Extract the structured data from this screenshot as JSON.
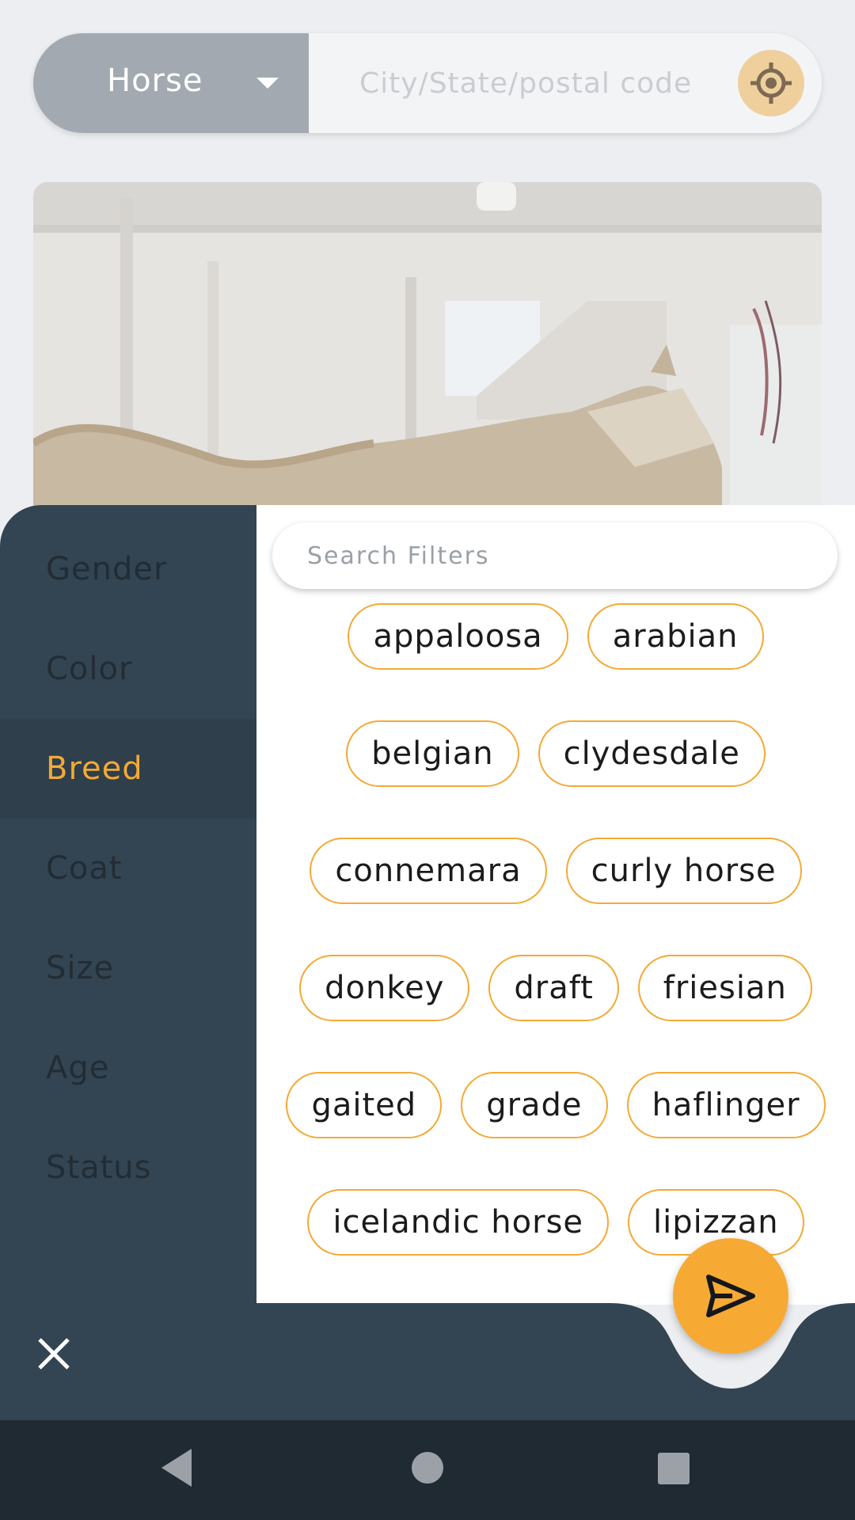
{
  "search_bar": {
    "species_value": "Horse",
    "location_placeholder": "City/State/postal code"
  },
  "filters": {
    "search_placeholder": "Search Filters",
    "categories": [
      "Gender",
      "Color",
      "Breed",
      "Coat",
      "Size",
      "Age",
      "Status"
    ],
    "active_category": "Breed",
    "breed_chip_rows": [
      [
        "appaloosa",
        "arabian"
      ],
      [
        "belgian",
        "clydesdale"
      ],
      [
        "connemara",
        "curly horse"
      ],
      [
        "donkey",
        "draft",
        "friesian"
      ],
      [
        "gaited",
        "grade",
        "haflinger"
      ],
      [
        "icelandic horse",
        "lipizzan"
      ]
    ]
  },
  "colors": {
    "accent": "#f6aa34",
    "sidebar_bg": "#334552",
    "nav_bar_bg": "#1f2a33"
  },
  "icons": {
    "locate": "crosshair-target-icon",
    "dropdown": "caret-down-icon",
    "close": "close-x-icon",
    "send": "paper-plane-send-icon",
    "nav_back": "triangle-back-icon",
    "nav_home": "circle-home-icon",
    "nav_recents": "square-recents-icon"
  }
}
